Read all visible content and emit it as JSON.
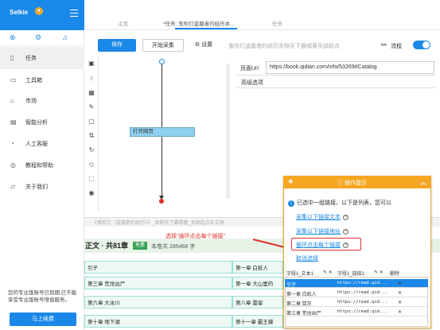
{
  "sidebar": {
    "brand": "Selkie",
    "items": [
      {
        "label": "任务",
        "icon": "document-icon"
      },
      {
        "label": "工具箱",
        "icon": "toolbox-icon"
      },
      {
        "label": "市场",
        "icon": "market-icon"
      },
      {
        "label": "智能分析",
        "icon": "analysis-icon"
      },
      {
        "label": "人工客服",
        "icon": "support-icon"
      },
      {
        "label": "教程和帮助",
        "icon": "help-icon"
      },
      {
        "label": "关于我们",
        "icon": "info-icon"
      }
    ],
    "notice": "您的专业版账号已到期,已不能享受专业版账号增值服务。",
    "renew_label": "马上续费"
  },
  "tabs": {
    "home": "主页",
    "task": "*任务: 鬼吹灯盗墓者的经历本...",
    "task2": "任务"
  },
  "toolbar": {
    "save": "保存",
    "start": "开始采集",
    "settings": "设置",
    "task_name": "鬼吹灯盗墓者的经历本物天下霸唱著贡辞起点",
    "flow": "流程"
  },
  "flow": {
    "node_label": "打开网页"
  },
  "page_url": {
    "label": "页面Url",
    "value": "https://book.qidian.com/info/53269#Catalog"
  },
  "advanced": "高级选项",
  "browser": {
    "address": "《鬼吹灯（盗墓者的经历）》_本物天下霸唱著_贡辞起点中文网",
    "chapter_title": "正文 · 共81章",
    "free": "免费",
    "volume_info": "本卷共 285468 字",
    "annotation": "选择\"循环点击每个链接\"",
    "cells_left": [
      "引子",
      "第三章 荒坟凶尸",
      "第六章 大冰川",
      "第十章 地下湖"
    ],
    "cells_right": [
      "第一章 白纸人",
      "第一章 大山里的",
      "第八章 雷留",
      "第十一章 霸王蝉"
    ]
  },
  "popup": {
    "title": "操作提示",
    "info": "已选中一组链接，以下是列表，您可以",
    "options": [
      "采集以下链接文本",
      "采集以下链接地址",
      "循环点击每个链接",
      "取消选择"
    ],
    "table": {
      "col1": "字段1_文本1",
      "col2": "字段1_链接1",
      "delete": "删除",
      "rows": [
        {
          "text": "引子",
          "link": "https://read.qid..."
        },
        {
          "text": "第一章 白纸人",
          "link": "https://read.qid..."
        },
        {
          "text": "第二章 鼠灰",
          "link": "https://read.qid..."
        },
        {
          "text": "第三章 荒坟凶尸",
          "link": "https://read.qid..."
        }
      ]
    }
  }
}
